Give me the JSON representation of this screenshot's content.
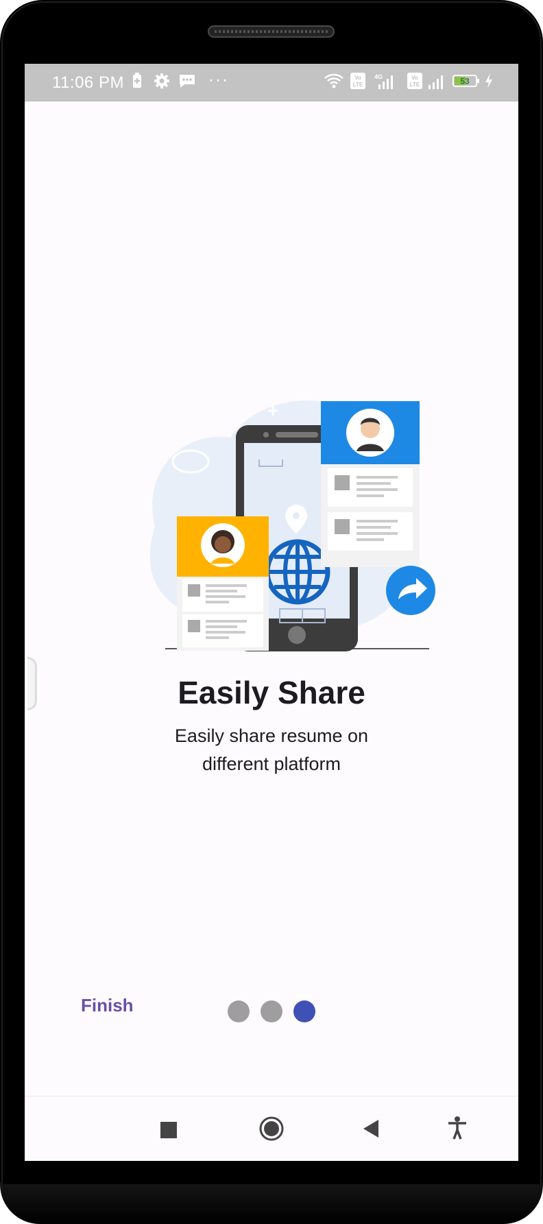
{
  "status_bar": {
    "time": "11:06 PM",
    "left_icons": [
      "battery-saver-icon",
      "settings-icon",
      "message-icon"
    ],
    "more": "···",
    "right_icons": [
      "wifi-icon",
      "volte-icon",
      "signal-4g-icon",
      "volte-icon",
      "signal-icon",
      "battery-icon",
      "charging-icon"
    ],
    "network_label": "4G",
    "volte_label": "Vo LTE",
    "battery_level": "53"
  },
  "onboarding": {
    "title": "Easily Share",
    "subtitle_line1": "Easily share resume on",
    "subtitle_line2": "different platform",
    "illustration_icon": "share-resume-illustration"
  },
  "controls": {
    "finish_label": "Finish",
    "page_count": 3,
    "active_page": 3,
    "colors": {
      "inactive_dot": "#9e9e9e",
      "active_dot": "#3f51b5",
      "finish_text": "#6750a4"
    }
  },
  "navigation_bar": {
    "buttons": [
      "recents-square-icon",
      "home-circle-icon",
      "back-triangle-icon",
      "accessibility-icon"
    ]
  },
  "colors": {
    "status_bar": "#c3c3c3",
    "screen_background": "#fefbfe",
    "text": "#1d1b20",
    "accent_blue": "#1e88e5",
    "accent_yellow": "#ffb300"
  }
}
